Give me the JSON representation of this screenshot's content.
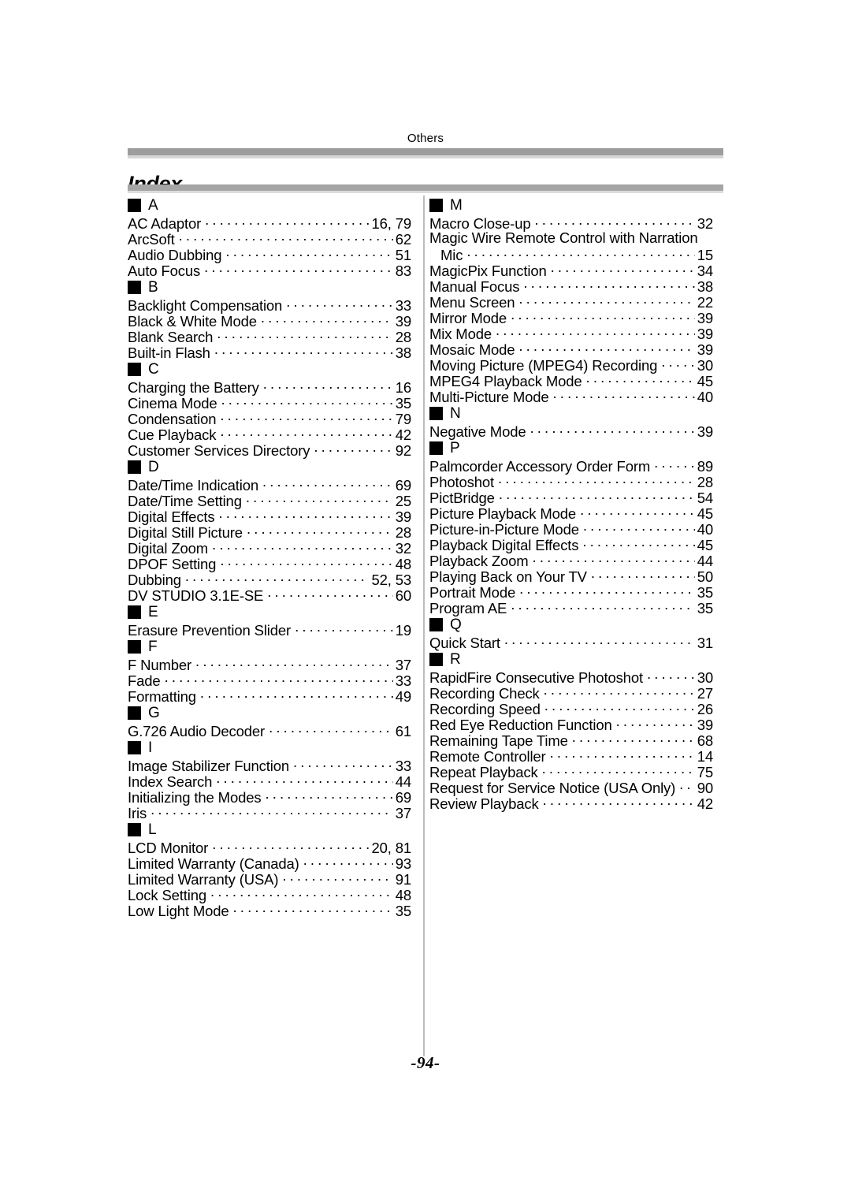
{
  "header": {
    "running_head": "Others",
    "chapter_title": "Index"
  },
  "footer": {
    "page_number": "-94-"
  },
  "colors": {
    "rule_dark": "#9d9d9d",
    "rule_light": "#d6d6d6",
    "divider": "#bdbdbd",
    "square": "#000000",
    "text": "#000000",
    "background": "#ffffff"
  },
  "index": {
    "left_column": [
      {
        "letter": "A",
        "entries": [
          {
            "title": "AC Adaptor",
            "page": "16, 79"
          },
          {
            "title": "ArcSoft",
            "page": "62"
          },
          {
            "title": "Audio Dubbing",
            "page": "51"
          },
          {
            "title": "Auto Focus",
            "page": "83"
          }
        ]
      },
      {
        "letter": "B",
        "entries": [
          {
            "title": "Backlight Compensation",
            "page": "33"
          },
          {
            "title": "Black & White Mode",
            "page": "39"
          },
          {
            "title": "Blank Search",
            "page": "28"
          },
          {
            "title": "Built-in Flash",
            "page": "38"
          }
        ]
      },
      {
        "letter": "C",
        "entries": [
          {
            "title": "Charging the Battery",
            "page": "16"
          },
          {
            "title": "Cinema Mode",
            "page": "35"
          },
          {
            "title": "Condensation",
            "page": "79"
          },
          {
            "title": "Cue Playback",
            "page": "42"
          },
          {
            "title": "Customer Services Directory",
            "page": "92"
          }
        ]
      },
      {
        "letter": "D",
        "entries": [
          {
            "title": "Date/Time Indication",
            "page": "69"
          },
          {
            "title": "Date/Time Setting",
            "page": "25"
          },
          {
            "title": "Digital Effects",
            "page": "39"
          },
          {
            "title": "Digital Still Picture",
            "page": "28"
          },
          {
            "title": "Digital Zoom",
            "page": "32"
          },
          {
            "title": "DPOF Setting",
            "page": "48"
          },
          {
            "title": "Dubbing",
            "page": "52, 53"
          },
          {
            "title": "DV STUDIO 3.1E-SE",
            "page": "60"
          }
        ]
      },
      {
        "letter": "E",
        "entries": [
          {
            "title": "Erasure Prevention Slider",
            "page": "19"
          }
        ]
      },
      {
        "letter": "F",
        "entries": [
          {
            "title": "F Number",
            "page": "37"
          },
          {
            "title": "Fade",
            "page": "33"
          },
          {
            "title": "Formatting",
            "page": "49"
          }
        ]
      },
      {
        "letter": "G",
        "entries": [
          {
            "title": "G.726 Audio Decoder",
            "page": "61"
          }
        ]
      },
      {
        "letter": "I",
        "entries": [
          {
            "title": "Image Stabilizer Function",
            "page": "33"
          },
          {
            "title": "Index Search",
            "page": "44"
          },
          {
            "title": "Initializing the Modes",
            "page": "69"
          },
          {
            "title": "Iris",
            "page": "37"
          }
        ]
      },
      {
        "letter": "L",
        "entries": [
          {
            "title": "LCD Monitor",
            "page": "20, 81"
          },
          {
            "title": "Limited Warranty (Canada)",
            "page": "93"
          },
          {
            "title": "Limited Warranty (USA)",
            "page": "91"
          },
          {
            "title": "Lock Setting",
            "page": "48"
          },
          {
            "title": "Low Light Mode",
            "page": "35"
          }
        ]
      }
    ],
    "right_column": [
      {
        "letter": "M",
        "entries": [
          {
            "title": "Macro Close-up",
            "page": "32"
          },
          {
            "title": "Magic Wire Remote Control with Narration",
            "continuation": "Mic",
            "page": "15"
          },
          {
            "title": "MagicPix Function",
            "page": "34"
          },
          {
            "title": "Manual Focus",
            "page": "38"
          },
          {
            "title": "Menu Screen",
            "page": "22"
          },
          {
            "title": "Mirror Mode",
            "page": "39"
          },
          {
            "title": "Mix Mode",
            "page": "39"
          },
          {
            "title": "Mosaic Mode",
            "page": "39"
          },
          {
            "title": "Moving Picture (MPEG4) Recording",
            "page": "30"
          },
          {
            "title": "MPEG4 Playback Mode",
            "page": "45"
          },
          {
            "title": "Multi-Picture Mode",
            "page": "40"
          }
        ]
      },
      {
        "letter": "N",
        "entries": [
          {
            "title": "Negative Mode",
            "page": "39"
          }
        ]
      },
      {
        "letter": "P",
        "entries": [
          {
            "title": "Palmcorder Accessory Order Form",
            "page": "89"
          },
          {
            "title": "Photoshot",
            "page": "28"
          },
          {
            "title": "PictBridge",
            "page": "54"
          },
          {
            "title": "Picture Playback Mode",
            "page": "45"
          },
          {
            "title": "Picture-in-Picture Mode",
            "page": "40"
          },
          {
            "title": "Playback Digital Effects",
            "page": "45"
          },
          {
            "title": "Playback Zoom",
            "page": "44"
          },
          {
            "title": "Playing Back on Your TV",
            "page": "50"
          },
          {
            "title": "Portrait Mode",
            "page": "35"
          },
          {
            "title": "Program AE",
            "page": "35"
          }
        ]
      },
      {
        "letter": "Q",
        "entries": [
          {
            "title": "Quick Start",
            "page": "31"
          }
        ]
      },
      {
        "letter": "R",
        "entries": [
          {
            "title": "RapidFire Consecutive Photoshot",
            "page": "30"
          },
          {
            "title": "Recording Check",
            "page": "27"
          },
          {
            "title": "Recording Speed",
            "page": "26"
          },
          {
            "title": "Red Eye Reduction Function",
            "page": "39"
          },
          {
            "title": "Remaining Tape Time",
            "page": "68"
          },
          {
            "title": "Remote Controller",
            "page": "14"
          },
          {
            "title": "Repeat Playback",
            "page": "75"
          },
          {
            "title": "Request for Service Notice (USA Only)",
            "page": "90"
          },
          {
            "title": "Review Playback",
            "page": "42"
          }
        ]
      }
    ]
  }
}
